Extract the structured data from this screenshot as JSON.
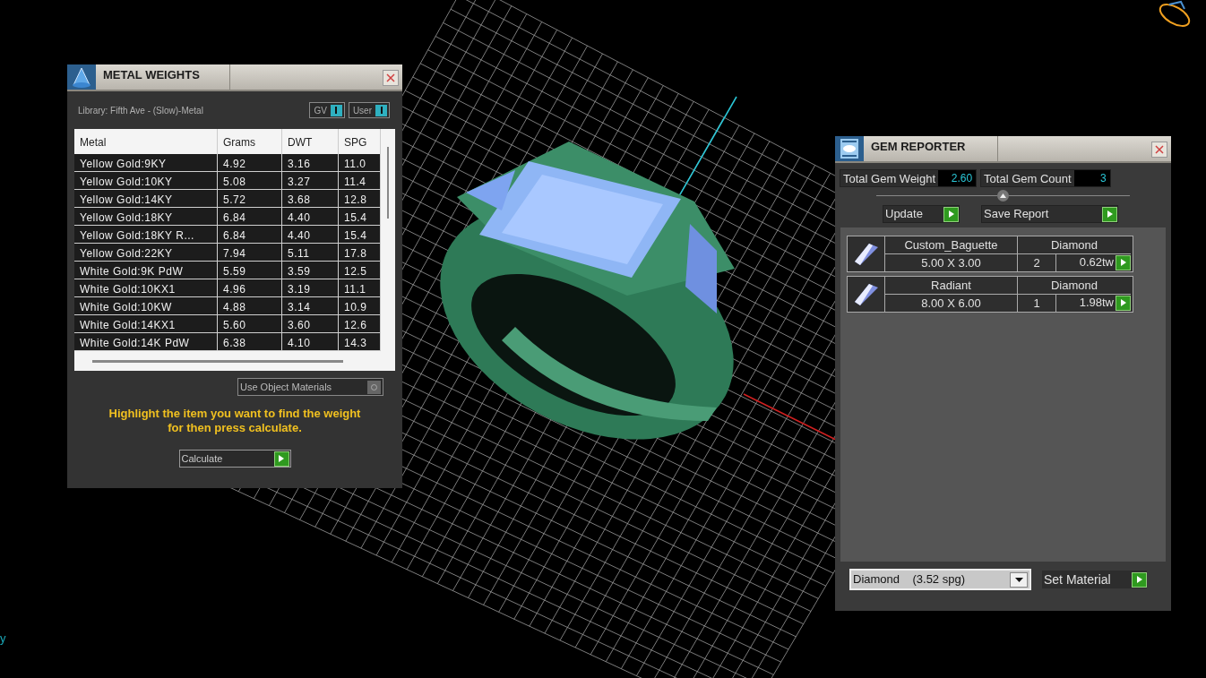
{
  "metal_weights": {
    "title": "METAL WEIGHTS",
    "library": "Library: Fifth Ave - (Slow)-Metal",
    "toggles": [
      {
        "label": "GV",
        "on": true
      },
      {
        "label": "User",
        "on": true
      }
    ],
    "table": {
      "columns": [
        "Metal",
        "Grams",
        "DWT",
        "SPG"
      ],
      "rows": [
        [
          "Yellow Gold:9KY",
          "4.92",
          "3.16",
          "11.0"
        ],
        [
          "Yellow Gold:10KY",
          "5.08",
          "3.27",
          "11.4"
        ],
        [
          "Yellow Gold:14KY",
          "5.72",
          "3.68",
          "12.8"
        ],
        [
          "Yellow Gold:18KY",
          "6.84",
          "4.40",
          "15.4"
        ],
        [
          "Yellow Gold:18KY R...",
          "6.84",
          "4.40",
          "15.4"
        ],
        [
          "Yellow Gold:22KY",
          "7.94",
          "5.11",
          "17.8"
        ],
        [
          "White Gold:9K PdW",
          "5.59",
          "3.59",
          "12.5"
        ],
        [
          "White Gold:10KX1",
          "4.96",
          "3.19",
          "11.1"
        ],
        [
          "White Gold:10KW",
          "4.88",
          "3.14",
          "10.9"
        ],
        [
          "White Gold:14KX1",
          "5.60",
          "3.60",
          "12.6"
        ],
        [
          "White Gold:14K PdW",
          "6.38",
          "4.10",
          "14.3"
        ]
      ]
    },
    "use_object_materials": {
      "label": "Use Object Materials",
      "on": false
    },
    "hint": "Highlight the item you want to find the weight for then press calculate.",
    "calculate_button": "Calculate"
  },
  "gem_reporter": {
    "title": "GEM REPORTER",
    "totals": [
      {
        "label": "Total Gem Weight",
        "value": "2.60"
      },
      {
        "label": "Total Gem Count",
        "value": "3"
      }
    ],
    "buttons": [
      "Update",
      "Save Report"
    ],
    "gems": [
      {
        "shape": "Custom_Baguette",
        "material": "Diamond",
        "size": "5.00 X 3.00",
        "count": "2",
        "weight": "0.62tw"
      },
      {
        "shape": "Radiant",
        "material": "Diamond",
        "size": "8.00 X 6.00",
        "count": "1",
        "weight": "1.98tw"
      }
    ],
    "material_select": {
      "value": "Diamond    (3.52 spg)"
    },
    "set_material_button": "Set Material"
  },
  "axis_label": "y"
}
